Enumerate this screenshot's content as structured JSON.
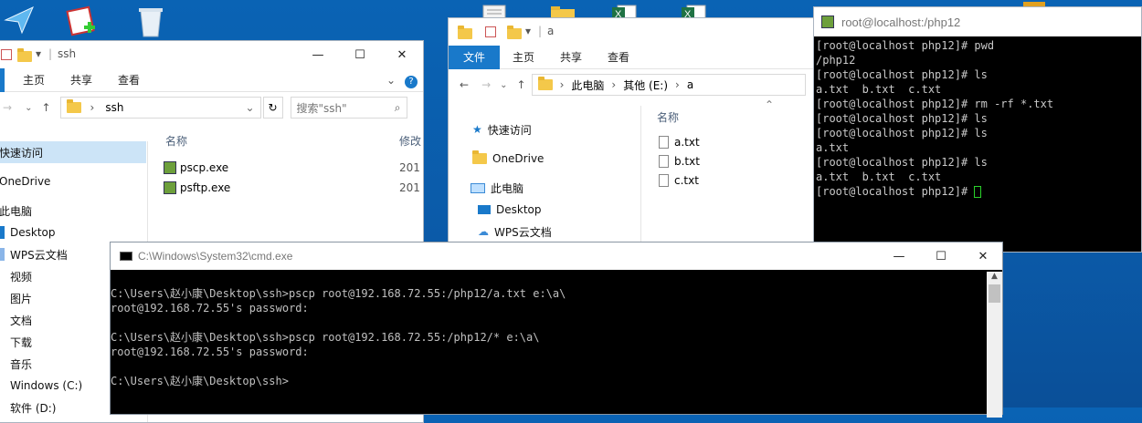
{
  "desktop": {
    "icons": [
      "send-icon",
      "notepad-plus-icon",
      "recycle-bin-icon",
      "document-icon",
      "folder-icon",
      "excel-icon",
      "excel-icon"
    ]
  },
  "ssh_explorer": {
    "title": "ssh",
    "tabs": [
      "主页",
      "共享",
      "查看"
    ],
    "path": "ssh",
    "search_placeholder": "搜索\"ssh\"",
    "column_name": "名称",
    "column_modified": "修改",
    "nav": [
      "快速访问",
      "OneDrive",
      "此电脑",
      "Desktop",
      "WPS云文档",
      "视频",
      "图片",
      "文档",
      "下载",
      "音乐",
      "Windows (C:)",
      "软件 (D:)"
    ],
    "files": [
      {
        "name": "pscp.exe",
        "date": "201"
      },
      {
        "name": "psftp.exe",
        "date": "201"
      }
    ]
  },
  "a_explorer": {
    "title": "a",
    "tabs": [
      "文件",
      "主页",
      "共享",
      "查看"
    ],
    "path": [
      "此电脑",
      "其他 (E:)",
      "a"
    ],
    "column_name": "名称",
    "nav": [
      "快速访问",
      "OneDrive",
      "此电脑",
      "Desktop",
      "WPS云文档"
    ],
    "files": [
      "a.txt",
      "b.txt",
      "c.txt"
    ]
  },
  "putty": {
    "title": "root@localhost:/php12",
    "lines": [
      "[root@localhost php12]# pwd",
      "/php12",
      "[root@localhost php12]# ls",
      "a.txt  b.txt  c.txt",
      "[root@localhost php12]# rm -rf *.txt",
      "[root@localhost php12]# ls",
      "[root@localhost php12]# ls",
      "a.txt",
      "[root@localhost php12]# ls",
      "a.txt  b.txt  c.txt"
    ],
    "prompt": "[root@localhost php12]# "
  },
  "cmd": {
    "title": "C:\\Windows\\System32\\cmd.exe",
    "lines": [
      "",
      "C:\\Users\\赵小康\\Desktop\\ssh>pscp root@192.168.72.55:/php12/a.txt e:\\a\\",
      "root@192.168.72.55's password:",
      "",
      "C:\\Users\\赵小康\\Desktop\\ssh>pscp root@192.168.72.55:/php12/* e:\\a\\",
      "root@192.168.72.55's password:",
      "",
      "C:\\Users\\赵小康\\Desktop\\ssh>"
    ]
  }
}
